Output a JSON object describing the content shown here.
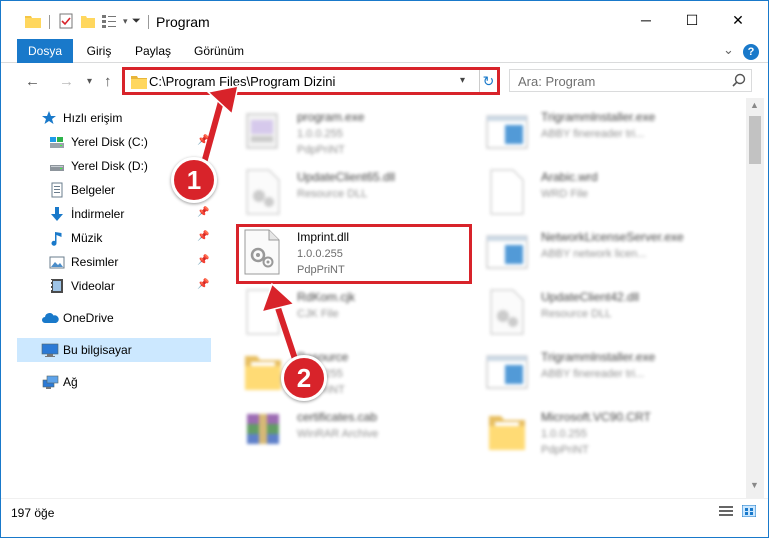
{
  "window": {
    "title": "Program",
    "controls": {
      "minimize": "─",
      "maximize": "☐",
      "close": "✕"
    }
  },
  "ribbon": {
    "tabs": [
      {
        "label": "Dosya",
        "active": true
      },
      {
        "label": "Giriş",
        "active": false
      },
      {
        "label": "Paylaş",
        "active": false
      },
      {
        "label": "Görünüm",
        "active": false
      }
    ],
    "help": "?"
  },
  "nav": {
    "address": "C:\\Program Files\\Program Dizini",
    "search_placeholder": "Ara: Program"
  },
  "sidebar": {
    "items": [
      {
        "label": "Hızlı erişim",
        "icon": "star-icon"
      },
      {
        "label": "Yerel Disk (C:)",
        "icon": "drive-icon",
        "pinned": true
      },
      {
        "label": "Yerel Disk (D:)",
        "icon": "drive-icon",
        "pinned": false
      },
      {
        "label": "Belgeler",
        "icon": "documents-icon",
        "pinned": false
      },
      {
        "label": "İndirmeler",
        "icon": "downloads-icon",
        "pinned": true
      },
      {
        "label": "Müzik",
        "icon": "music-icon",
        "pinned": true
      },
      {
        "label": "Resimler",
        "icon": "pictures-icon",
        "pinned": true
      },
      {
        "label": "Videolar",
        "icon": "videos-icon",
        "pinned": true
      },
      {
        "label": "OneDrive",
        "icon": "onedrive-icon"
      },
      {
        "label": "Bu bilgisayar",
        "icon": "computer-icon",
        "selected": true
      },
      {
        "label": "Ağ",
        "icon": "network-icon"
      }
    ]
  },
  "files": [
    {
      "name": "program.exe",
      "line1": "1.0.0.255",
      "line2": "PdpPriNT",
      "icon": "program-exe-icon",
      "blurred": true
    },
    {
      "name": "Trigrammlnstaller.exe",
      "line1": "ABBY finereader tri...",
      "line2": "",
      "icon": "exe-window-icon",
      "blurred": true
    },
    {
      "name": "UpdateClient65.dll",
      "line1": "Resource DLL",
      "line2": "",
      "icon": "dll-icon",
      "blurred": true
    },
    {
      "name": "Arabic.wrd",
      "line1": "WRD File",
      "line2": "",
      "icon": "blank-file-icon",
      "blurred": true
    },
    {
      "name": "Imprint.dll",
      "line1": "1.0.0.255",
      "line2": "PdpPriNT",
      "icon": "dll-icon",
      "blurred": false
    },
    {
      "name": "NetworkLicenseServer.exe",
      "line1": "ABBY network licen...",
      "line2": "",
      "icon": "exe-window-icon",
      "blurred": true
    },
    {
      "name": "RdKom.cjk",
      "line1": "CJK File",
      "line2": "",
      "icon": "blank-file-icon",
      "blurred": true
    },
    {
      "name": "UpdateClient42.dll",
      "line1": "Resource DLL",
      "line2": "",
      "icon": "dll-icon",
      "blurred": true
    },
    {
      "name": "Resource",
      "line1": "1.0.0.255",
      "line2": "PdpPriNT",
      "icon": "folder-doc-icon",
      "blurred": true
    },
    {
      "name": "Trigrammlnstaller.exe",
      "line1": "ABBY finereader tri...",
      "line2": "",
      "icon": "exe-window-icon",
      "blurred": true
    },
    {
      "name": "certificates.cab",
      "line1": "WinRAR Archive",
      "line2": "",
      "icon": "winrar-icon",
      "blurred": true
    },
    {
      "name": "Microsoft.VC90.CRT",
      "line1": "1.0.0.255",
      "line2": "PdpPriNT",
      "icon": "folder-doc-icon",
      "blurred": true
    }
  ],
  "status": {
    "count_text": "197 öğe"
  },
  "annotations": {
    "step1": "1",
    "step2": "2"
  },
  "colors": {
    "accent": "#1979ca",
    "annotation": "#d8232a",
    "selected_bg": "#cce8ff"
  }
}
